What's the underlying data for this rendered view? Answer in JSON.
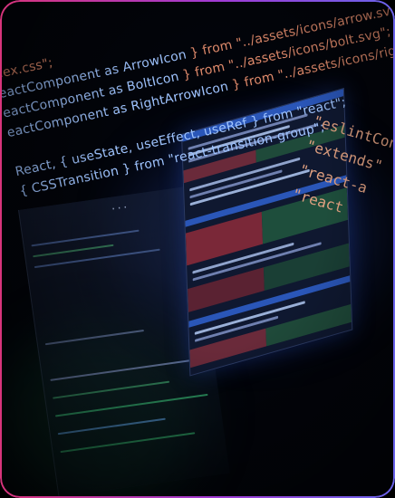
{
  "image": {
    "description_icon": "code-editor-photo",
    "frame_gradient": [
      "#d8347b",
      "#a03bd4",
      "#6a63ea"
    ],
    "code_lines": [
      [
        {
          "t": "dex.css\";",
          "c": "str"
        }
      ],
      [
        {
          "t": "eactComponent as ",
          "c": "id"
        },
        {
          "t": "ArrowIcon",
          "c": "id"
        },
        {
          "t": " } from \"../assets/icons/arrow.svg\";",
          "c": "str"
        }
      ],
      [
        {
          "t": "eactComponent as ",
          "c": "id"
        },
        {
          "t": "BoltIcon",
          "c": "id"
        },
        {
          "t": " } from \"../assets/icons/bolt.svg\";",
          "c": "str"
        }
      ],
      [
        {
          "t": "eactComponent as ",
          "c": "id"
        },
        {
          "t": "RightArrowIcon",
          "c": "id"
        },
        {
          "t": " } from \"../assets/icons/right-arrow.svg\";",
          "c": "str"
        }
      ],
      [
        {
          "t": "",
          "c": "pl"
        }
      ],
      [
        {
          "t": "React, { useState, useEffect, useRef } from \"react\";",
          "c": "id"
        }
      ],
      [
        {
          "t": "{ CSSTransition } from \"react-transition-group\";",
          "c": "id"
        }
      ]
    ],
    "right_code_lines": [
      [
        {
          "t": "\"eslintConfig\"",
          "c": "s"
        }
      ],
      [
        {
          "t": "  \"extends\"",
          "c": "s"
        }
      ],
      [
        {
          "t": "    \"react-a",
          "c": "s"
        }
      ],
      [
        {
          "t": "    \"react",
          "c": "s"
        }
      ]
    ]
  }
}
